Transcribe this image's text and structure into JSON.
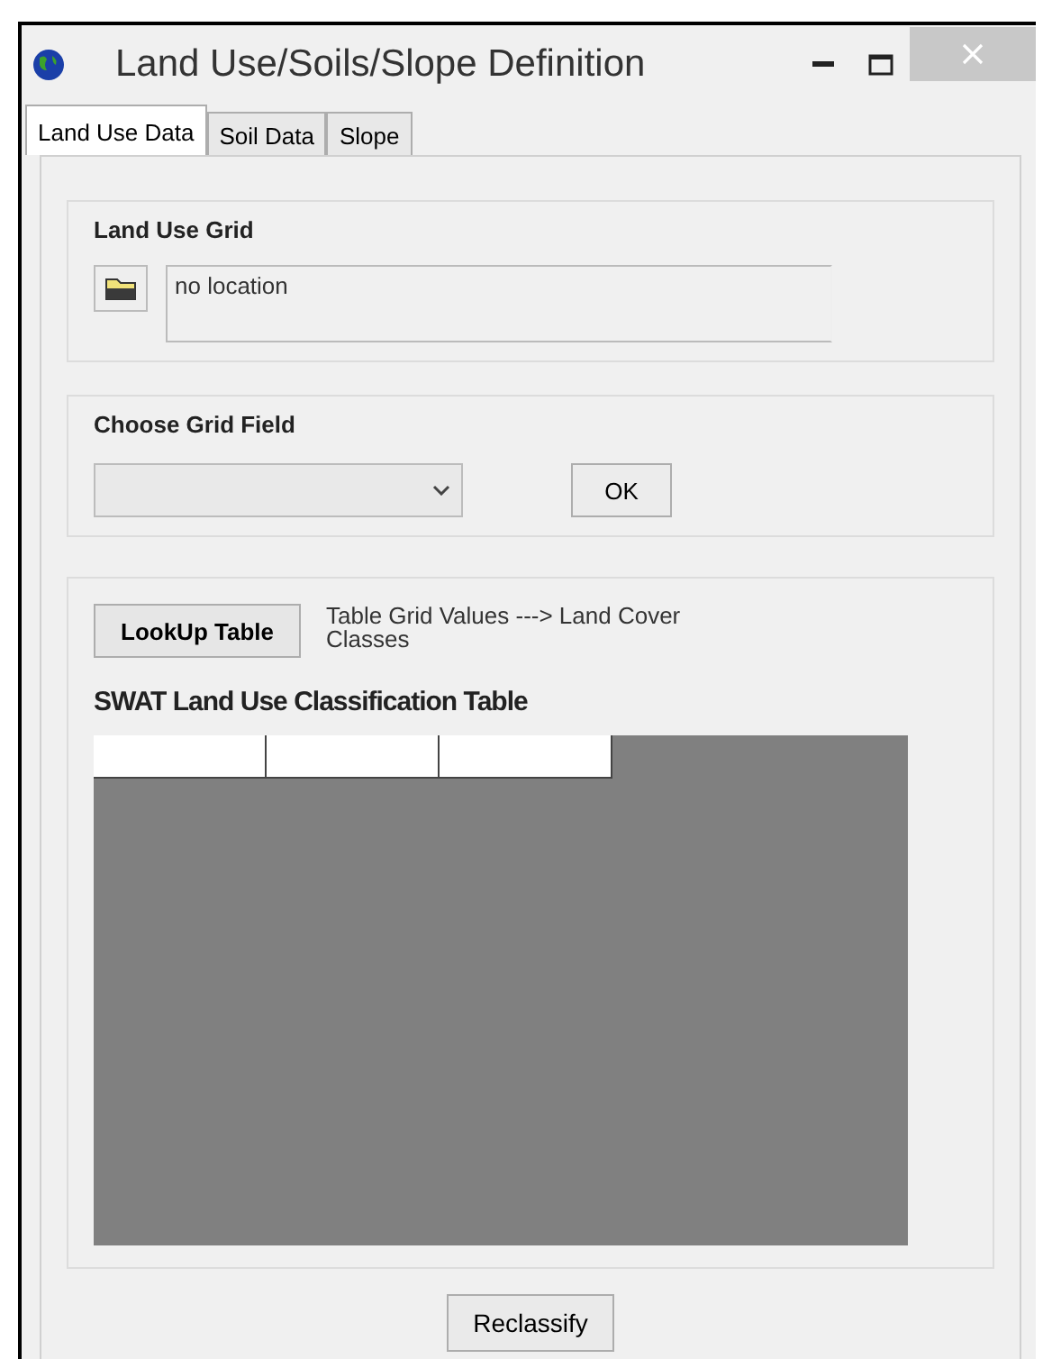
{
  "window": {
    "title": "Land Use/Soils/Slope Definition"
  },
  "tabs": [
    {
      "label": "Land Use Data",
      "selected": true
    },
    {
      "label": "Soil Data",
      "selected": false
    },
    {
      "label": "Slope",
      "selected": false
    }
  ],
  "land_use_grid": {
    "title": "Land Use Grid",
    "location": "no location"
  },
  "choose_grid_field": {
    "title": "Choose Grid Field",
    "ok_button": "OK"
  },
  "lookup": {
    "button": "LookUp Table",
    "note": "Table Grid Values ---> Land Cover Classes",
    "table_title": "SWAT Land Use Classification Table"
  },
  "reclassify_button": "Reclassify"
}
